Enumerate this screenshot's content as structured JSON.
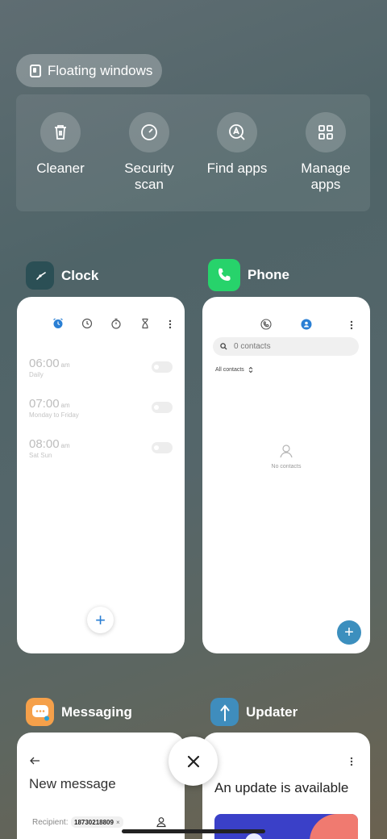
{
  "floating_windows": {
    "label": "Floating windows"
  },
  "tools": [
    {
      "label": "Cleaner",
      "icon": "trash-icon"
    },
    {
      "label": "Security\nscan",
      "icon": "security-scan-icon"
    },
    {
      "label": "Find apps",
      "icon": "find-apps-icon"
    },
    {
      "label": "Manage\napps",
      "icon": "grid-icon"
    }
  ],
  "apps": {
    "clock": {
      "name": "Clock",
      "alarms": [
        {
          "time": "06:00",
          "ampm": "am",
          "repeat": "Daily"
        },
        {
          "time": "07:00",
          "ampm": "am",
          "repeat": "Monday to Friday"
        },
        {
          "time": "08:00",
          "ampm": "am",
          "repeat": "Sat Sun"
        }
      ],
      "fab_label": "+"
    },
    "phone": {
      "name": "Phone",
      "search_placeholder": "0 contacts",
      "filter_label": "All contacts",
      "empty_text": "No contacts",
      "fab_label": "+"
    },
    "messaging": {
      "name": "Messaging",
      "title": "New message",
      "recipient_label": "Recipient:",
      "recipient_chip": "18730218809"
    },
    "updater": {
      "name": "Updater",
      "title": "An update is available"
    }
  },
  "colors": {
    "clock_icon_bg": "#2b4f55",
    "phone_icon_bg": "#27d36b",
    "messaging_icon_bg": "#f5a04a",
    "updater_icon_bg": "#3f8dbd",
    "accent_blue": "#2a7fd4"
  }
}
